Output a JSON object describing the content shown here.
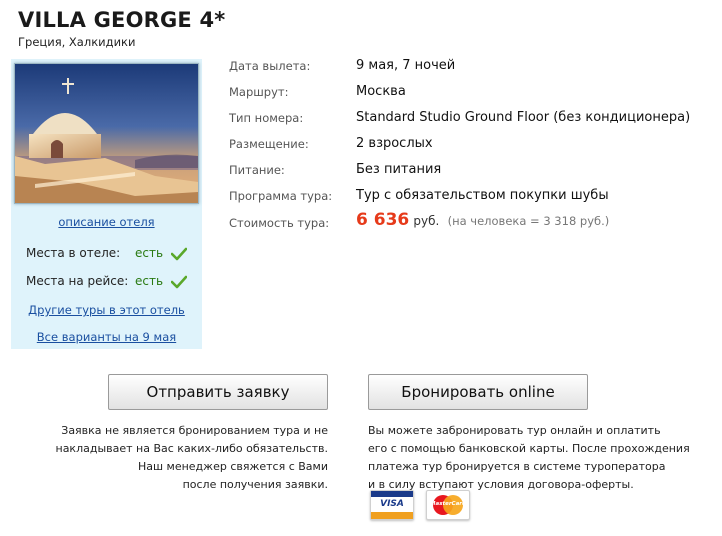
{
  "hotel": {
    "name": "VILLA GEORGE 4*",
    "location": "Греция, Халкидики"
  },
  "sidebar": {
    "description_link": "описание отеля",
    "hotel_places_label": "Места в отеле:",
    "hotel_places_value": "есть",
    "flight_places_label": "Места на рейсе:",
    "flight_places_value": "есть",
    "other_tours_link": "Другие туры в этот отель",
    "all_variants_link": "Все варианты на 9 мая"
  },
  "details": [
    {
      "label": "Дата вылета:",
      "value": "9 мая, 7 ночей"
    },
    {
      "label": "Маршрут:",
      "value": "Москва"
    },
    {
      "label": "Тип номера:",
      "value": "Standard Studio Ground Floor (без кондиционера)"
    },
    {
      "label": "Размещение:",
      "value": "2 взрослых"
    },
    {
      "label": "Питание:",
      "value": "Без питания"
    },
    {
      "label": "Программа тура:",
      "value": "Тур с обязательством покупки шубы"
    }
  ],
  "price": {
    "label": "Стоимость тура:",
    "amount": "6 636",
    "currency": "руб.",
    "per_person": "(на человека = 3 318 руб.)"
  },
  "actions": {
    "request_button": "Отправить заявку",
    "request_note": [
      "Заявка не является бронированием тура и не",
      "накладывает на Вас каких-либо обязательств.",
      "Наш менеджер свяжется с Вами",
      "после получения заявки."
    ],
    "book_button": "Бронировать online",
    "book_note": [
      "Вы можете забронировать тур онлайн и оплатить",
      "его с помощью банковской карты. После прохождения",
      "платежа тур бронируется в системе туроператора",
      "и в силу вступают условия договора-оферты."
    ]
  },
  "cards": {
    "visa": "VISA",
    "mastercard": "MasterCard"
  },
  "colors": {
    "sidebar_bg": "#dff3fb",
    "link": "#1a4fa0",
    "price": "#e63a1a",
    "available": "#2a7a12"
  }
}
